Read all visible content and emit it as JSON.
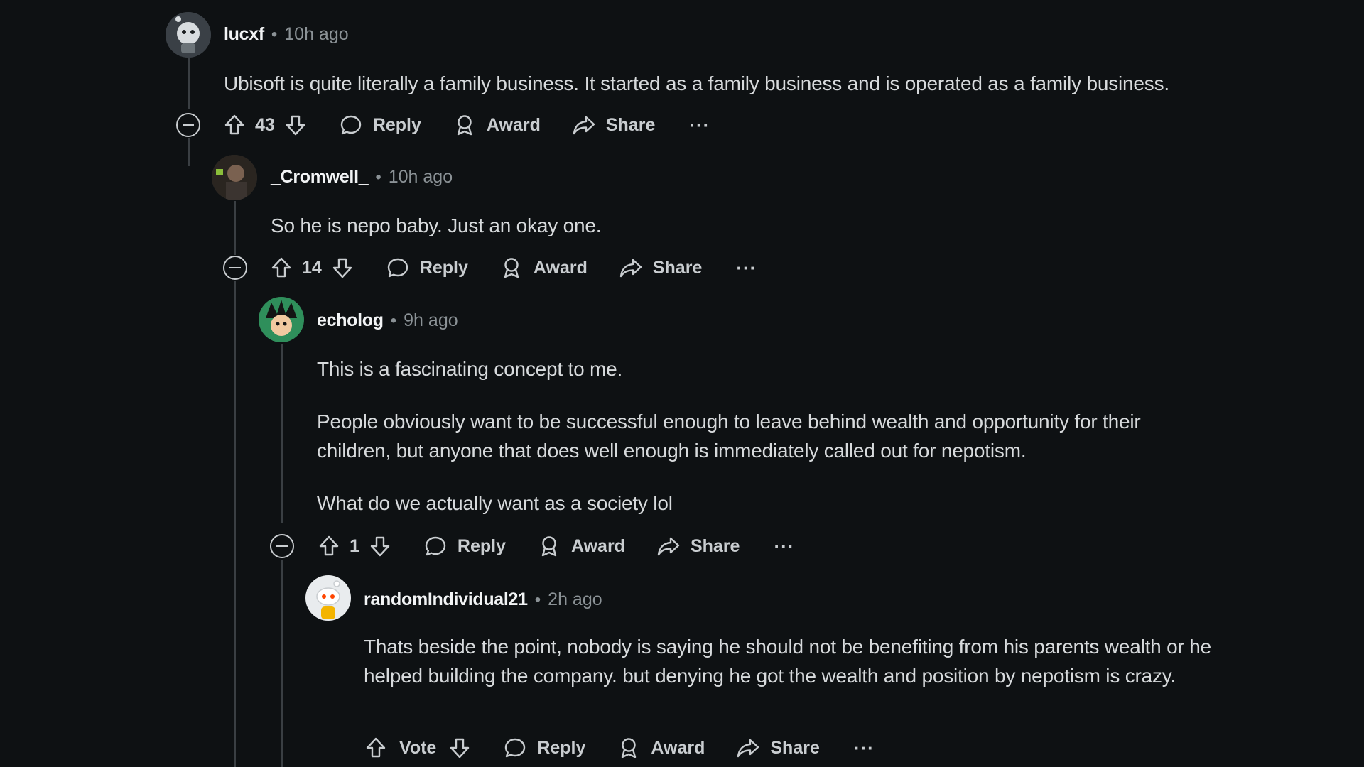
{
  "comments": [
    {
      "author": "lucxf",
      "time": "10h ago",
      "body": [
        "Ubisoft is quite literally a family business. It started as a family business and is operated as a family business."
      ],
      "score": "43",
      "actions": {
        "reply": "Reply",
        "award": "Award",
        "share": "Share",
        "more": "···"
      }
    },
    {
      "author": "_Cromwell_",
      "time": "10h ago",
      "body": [
        "So he is nepo baby. Just an okay one."
      ],
      "score": "14",
      "actions": {
        "reply": "Reply",
        "award": "Award",
        "share": "Share",
        "more": "···"
      }
    },
    {
      "author": "echolog",
      "time": "9h ago",
      "body": [
        "This is a fascinating concept to me.",
        "People obviously want to be successful enough to leave behind wealth and opportunity for their children, but anyone that does well enough is immediately called out for nepotism.",
        "What do we actually want as a society lol"
      ],
      "score": "1",
      "actions": {
        "reply": "Reply",
        "award": "Award",
        "share": "Share",
        "more": "···"
      }
    },
    {
      "author": "randomIndividual21",
      "time": "2h ago",
      "body": [
        "Thats beside the point, nobody is saying he should not be benefiting from his parents wealth or he helped building the company. but denying he got the wealth and position by nepotism is crazy."
      ],
      "score": "Vote",
      "actions": {
        "reply": "Reply",
        "award": "Award",
        "share": "Share",
        "more": "···"
      }
    }
  ],
  "separator": "•",
  "colors": {
    "background": "#0e1113",
    "text": "#d7dadc",
    "muted": "#8b9296",
    "thread_line": "#3a3f43"
  }
}
